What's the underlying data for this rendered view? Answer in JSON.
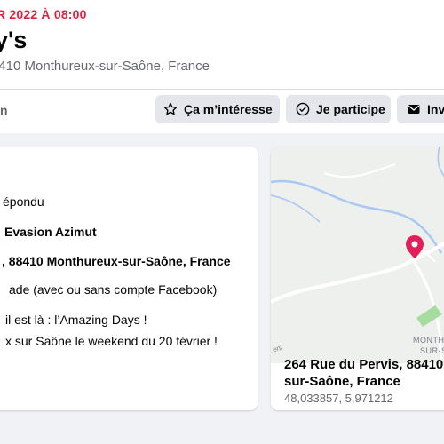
{
  "event": {
    "date": "R 2022 À 08:00",
    "title": "y's",
    "location": "8410 Monthureux-sur-Saône, France"
  },
  "nav": {
    "tab_partial": "n"
  },
  "actions": {
    "interested": {
      "label": "Ça m’intéresse",
      "icon": "star-icon"
    },
    "going": {
      "label": "Je participe",
      "icon": "check-circle-icon"
    },
    "invite": {
      "label": "Invi",
      "icon": "envelope-icon"
    }
  },
  "details": {
    "responded": "épondu",
    "organizer": "Evasion Azimut",
    "address": ", 88410 Monthureux-sur-Saône, France",
    "audience": "ade (avec ou sans compte Facebook)",
    "description_line1": "il est là : l’Amazing Days !",
    "description_line2": "x sur Saône le weekend du 20 février !"
  },
  "map": {
    "place_label_1": "MONTH",
    "place_label_2": "SUR-S",
    "edge_label": "ent",
    "address_line1": "264 Rue du Pervis, 88410",
    "address_line2": "sur-Saône, France",
    "coordinates": "48,033857, 5,971212",
    "pin_color": "#e41e5a",
    "river_color": "#a9c8f2",
    "park_color": "#a6dca0"
  }
}
